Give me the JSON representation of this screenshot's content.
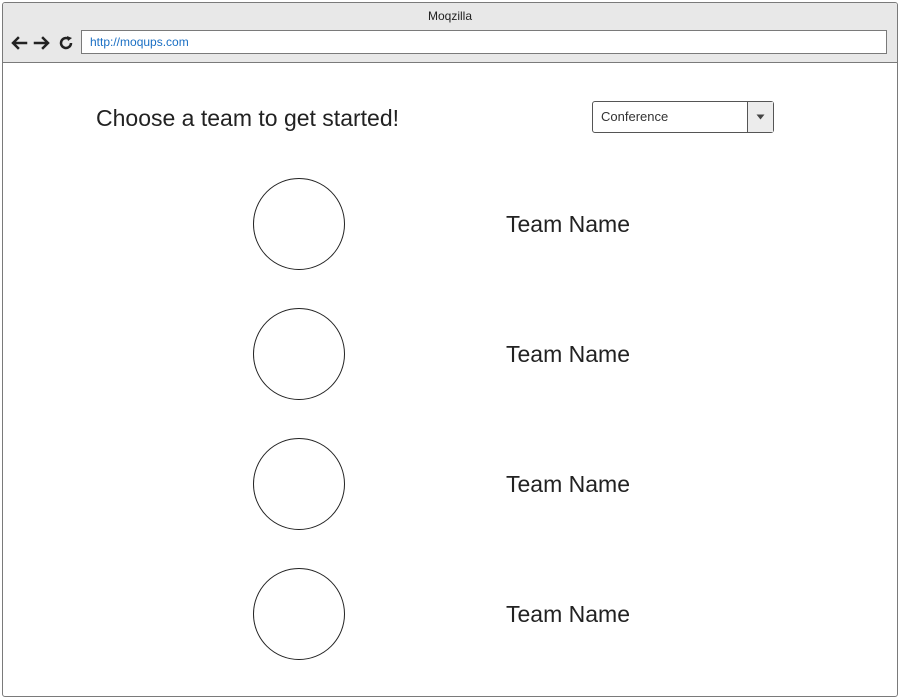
{
  "window": {
    "title": "Moqzilla"
  },
  "browser": {
    "back_icon": "arrow-left-icon",
    "forward_icon": "arrow-right-icon",
    "reload_icon": "reload-icon",
    "url": "http://moqups.com"
  },
  "page": {
    "title": "Choose a team to get started!",
    "conference_select": {
      "value": "Conference",
      "icon": "caret-down-icon"
    },
    "teams": [
      {
        "name": "Team Name"
      },
      {
        "name": "Team Name"
      },
      {
        "name": "Team Name"
      },
      {
        "name": "Team Name"
      }
    ]
  },
  "colors": {
    "url_text": "#1a6fc4",
    "chrome_background": "#e8e8e8"
  }
}
